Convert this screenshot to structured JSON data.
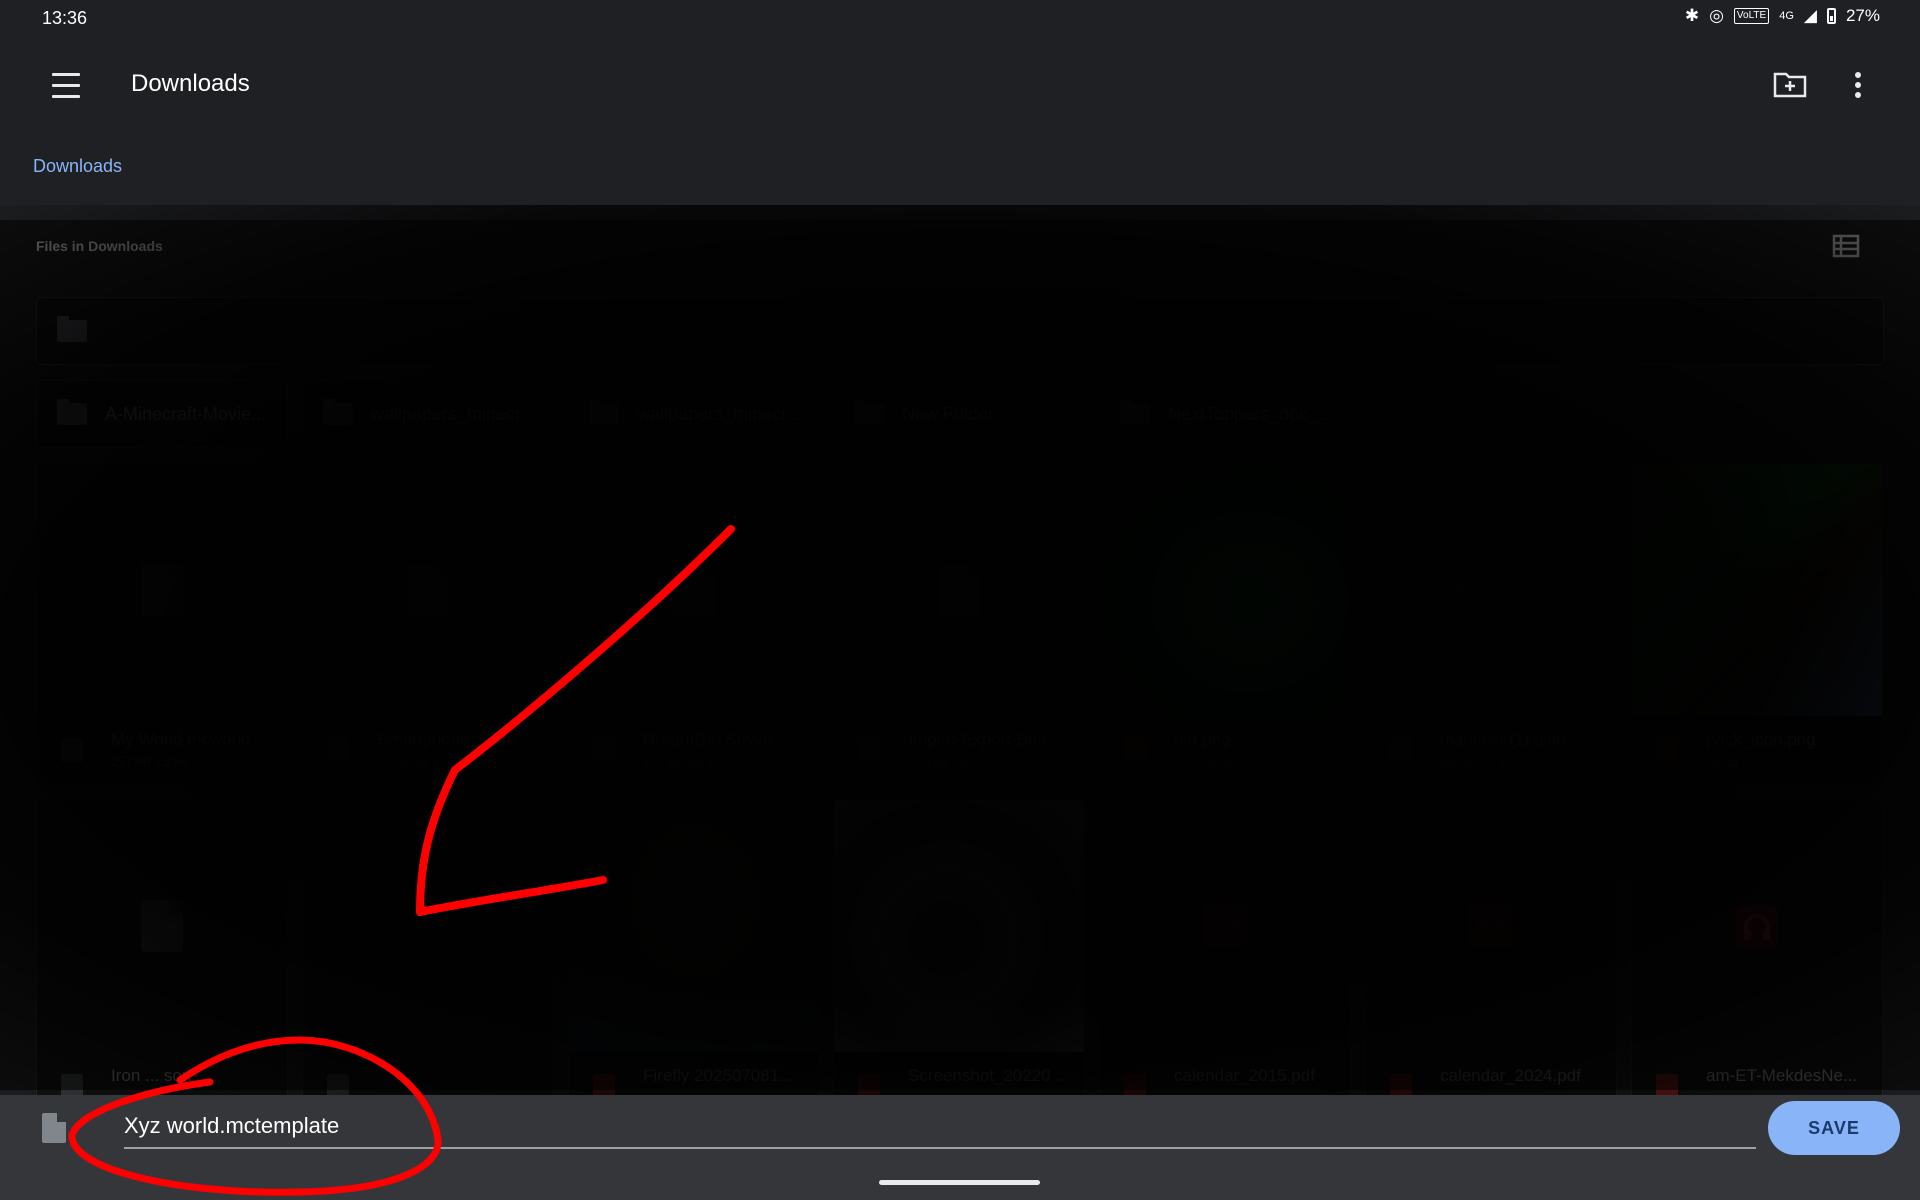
{
  "status_bar": {
    "time": "13:36",
    "battery": "27%",
    "volte": "VoLTE",
    "network": "4G"
  },
  "app_bar": {
    "title": "Downloads"
  },
  "breadcrumb": {
    "label": "Downloads"
  },
  "section": {
    "label": "Files in Downloads"
  },
  "folders": [
    {
      "name": "A-Minecraft-Movie..."
    },
    {
      "name": "wallpapers_minecr..."
    },
    {
      "name": "wallpapers_minecr..."
    },
    {
      "name": "New Folder"
    },
    {
      "name": "NextToppers_doc_..."
    }
  ],
  "files_row1": [
    {
      "name": "My World.mcworld",
      "sub": "257 kB 13:54"
    },
    {
      "name": "Smartphone_Type...",
      "sub": "51.09 kB 13:03"
    },
    {
      "name": "DreamGirl Savier",
      "sub": "171 kB Jul 11"
    },
    {
      "name": "Import-Export-Butt...",
      "sub": "225 kB Jul 11"
    },
    {
      "name": "dirt.png",
      "sub": "1.54 kB Jul 11"
    },
    {
      "name": "manifest (1).json",
      "sub": "699 B Jul 11"
    },
    {
      "name": "pack_icon.png",
      "sub": "Jul 11"
    }
  ],
  "files_row2": [
    {
      "name": "Iron ... son ..."
    },
    {
      "name": ""
    },
    {
      "name": "Firefly 202507081..."
    },
    {
      "name": "Screenshot_20220..."
    },
    {
      "name": "calendar_2015.pdf"
    },
    {
      "name": "calendar_2024.pdf"
    },
    {
      "name": "am-ET-MekdesNe..."
    }
  ],
  "pdf_label": "PDF",
  "save_bar": {
    "filename": "Xyz world.mctemplate",
    "save_label": "SAVE"
  },
  "colors": {
    "accent": "#8ab4f8",
    "background": "#202124",
    "annotation": "#ff0000"
  }
}
